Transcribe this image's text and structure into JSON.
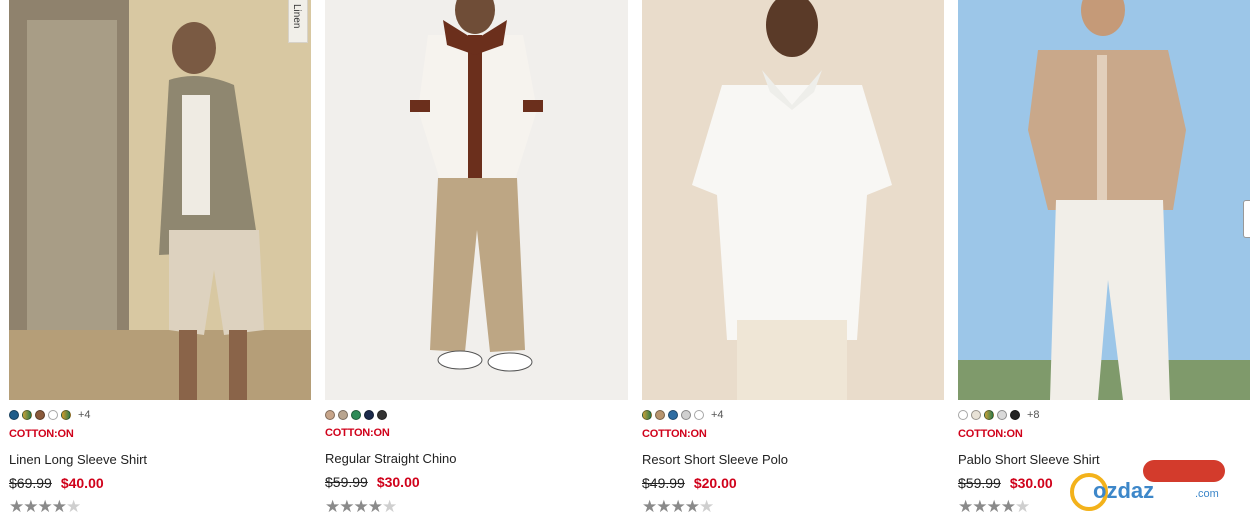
{
  "colors": {
    "brand_red": "#d0021b",
    "price_red": "#d0021b",
    "star_filled": "#8a8a8a",
    "star_empty": "#cfcfcf"
  },
  "products": [
    {
      "brand": "COTTON:ON",
      "name": "Linen Long Sleeve Shirt",
      "was_price": "$69.99",
      "sale_price": "$40.00",
      "more_colors": "+4",
      "swatches": [
        "#1f5c8a",
        "#c9a23a",
        "#8a5a3b",
        "#ffffff",
        "#d49b2a"
      ],
      "rating": 4.5,
      "image_tag": "Linen"
    },
    {
      "brand": "COTTON:ON",
      "name": "Regular Straight Chino",
      "was_price": "$59.99",
      "sale_price": "$30.00",
      "more_colors": "",
      "swatches": [
        "#c7a58a",
        "#b8a48f",
        "#2e8b57",
        "#1b2a4a",
        "#333333"
      ],
      "rating": 4.5
    },
    {
      "brand": "COTTON:ON",
      "name": "Resort Short Sleeve Polo",
      "was_price": "$49.99",
      "sale_price": "$20.00",
      "more_colors": "+4",
      "swatches": [
        "#c9a23a",
        "#b8956f",
        "#2d6ca2",
        "#d0d0d0",
        "#ffffff"
      ],
      "rating": 4
    },
    {
      "brand": "COTTON:ON",
      "name": "Pablo Short Sleeve Shirt",
      "was_price": "$59.99",
      "sale_price": "$30.00",
      "more_colors": "+8",
      "swatches": [
        "#ffffff",
        "#e8e2d6",
        "#c9a23a",
        "#d9d9d9",
        "#222222"
      ],
      "rating": 4
    }
  ],
  "watermark": {
    "text": "ozdaz",
    "suffix": ".com"
  }
}
